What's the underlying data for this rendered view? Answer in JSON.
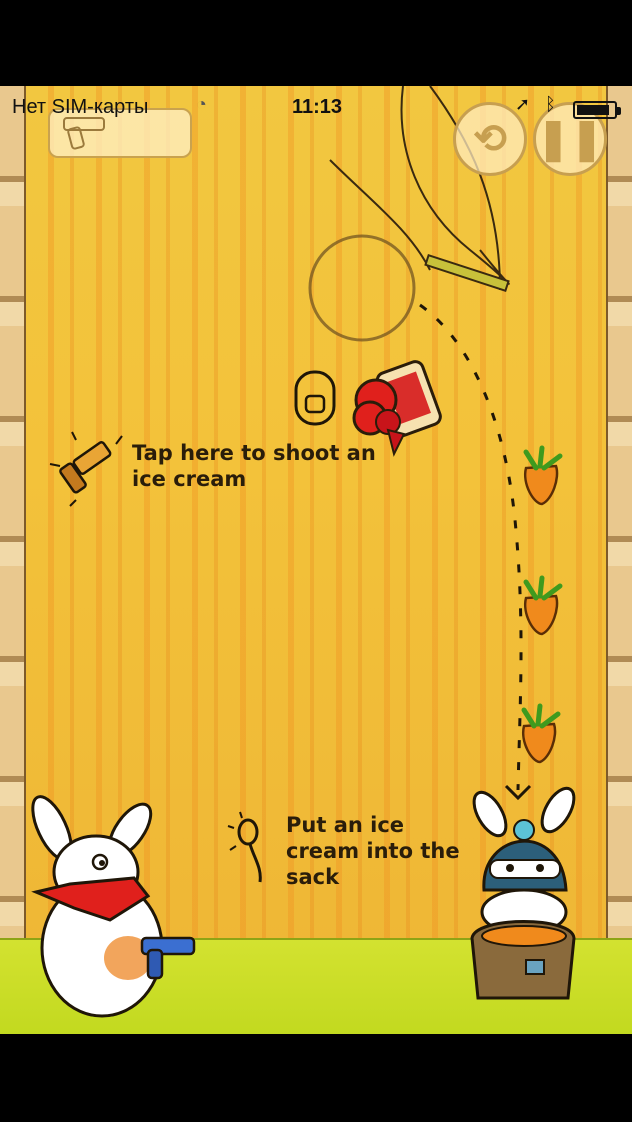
{
  "status_bar": {
    "carrier": "Нет SIM-карты",
    "time": "11:13",
    "battery_level": 0.9
  },
  "hud": {
    "weapon_icon": "revolver-icon",
    "restart_icon": "restart-icon",
    "pause_icon": "pause-icon"
  },
  "hints": {
    "shoot_line1": "Tap here to shoot an",
    "shoot_line2": "ice cream",
    "sack_line1": "Put an ice",
    "sack_line2": "cream into the",
    "sack_line3": "sack"
  },
  "colors": {
    "background": "#f2c740",
    "floor": "#c9dc26",
    "text": "#2a1d0a",
    "carrot": "#f08a1c"
  },
  "collectibles": {
    "carrot_count": 3
  }
}
